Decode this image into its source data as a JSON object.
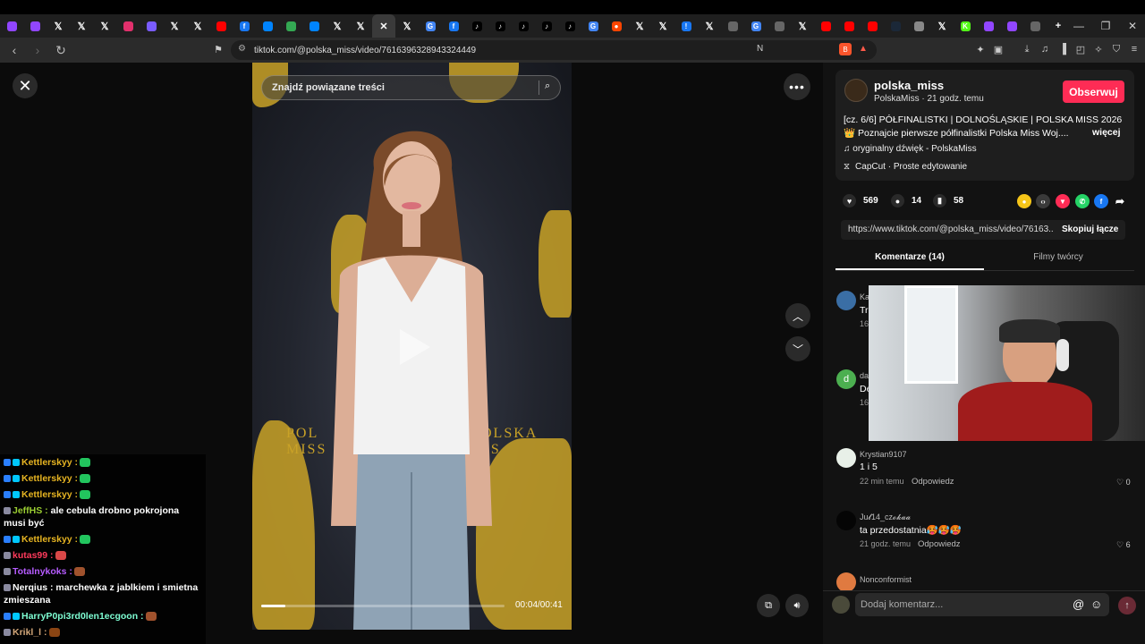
{
  "browser": {
    "url": "tiktok.com/@polska_miss/video/7616396328943324449",
    "tab_icons": [
      "twitch",
      "twitch",
      "x",
      "x",
      "x",
      "instagram",
      "feather",
      "x",
      "x",
      "youtube",
      "facebook",
      "messenger",
      "chat",
      "messenger",
      "x",
      "x",
      "close",
      "x",
      "google",
      "facebook",
      "tiktok",
      "tiktok",
      "tiktok",
      "tiktok",
      "tiktok",
      "google",
      "reddit",
      "x",
      "x",
      "exclaim",
      "x",
      "globe",
      "google",
      "globe",
      "x",
      "youtube",
      "youtube",
      "youtube",
      "steam",
      "database",
      "x",
      "kick",
      "twitch",
      "twitch",
      "globe",
      "plus"
    ],
    "window_controls": [
      "—",
      "❐",
      "✕"
    ]
  },
  "search": {
    "placeholder": "Znajdź powiązane treści"
  },
  "video": {
    "time": "00:04/00:41",
    "progress": 0.1
  },
  "chat": [
    {
      "user": "Kettlerskyy :",
      "text": "",
      "color": "#e6b422",
      "badge": true
    },
    {
      "user": "Kettlerskyy :",
      "text": "",
      "color": "#e6b422",
      "badge": true
    },
    {
      "user": "Kettlerskyy :",
      "text": "",
      "color": "#e6b422",
      "badge": true
    },
    {
      "user": "JeffHS :",
      "text": " ale cebula drobno pokrojona musi być",
      "color": "#9acd32",
      "badge": false
    },
    {
      "user": "Kettlerskyy :",
      "text": "",
      "color": "#e6b422",
      "badge": true
    },
    {
      "user": "kutas99 :",
      "text": "",
      "color": "#ff3b5c",
      "badge": false
    },
    {
      "user": "Totalnykoks :",
      "text": "",
      "color": "#b65cff",
      "badge": false
    },
    {
      "user": "Nerqius :",
      "text": " marchewka z jablkiem i smietna zmieszana",
      "color": "#ffffff",
      "badge": false
    },
    {
      "user": "HarryP0pi3rd0len1ecgoon :",
      "text": "",
      "color": "#7fffd4",
      "badge": true
    },
    {
      "user": "Krikl_l :",
      "text": "",
      "color": "#d2a679",
      "badge": false
    }
  ],
  "author": {
    "name": "polska_miss",
    "sub": "PolskaMiss · 21 godz. temu",
    "follow": "Obserwuj"
  },
  "description": {
    "line1": "[cz. 6/6] PÓŁFINALISTKI | DOLNOŚLĄSKIE | POLSKA MISS 2026",
    "line2": "👑 Poznajcie pierwsze półfinalistki Polska Miss Woj....",
    "more": "więcej",
    "sound": "♫  oryginalny dźwięk - PolskaMiss",
    "capcut": "CapCut · Proste edytowanie"
  },
  "stats": {
    "likes": "569",
    "comments": "14",
    "saves": "58"
  },
  "link": {
    "url": "https://www.tiktok.com/@polska_miss/video/76163...",
    "copy": "Skopiuj łącze"
  },
  "tabs": {
    "comments": "Komentarze (14)",
    "creator": "Filmy twórcy"
  },
  "comments": [
    {
      "name": "Ka",
      "text": "Tr",
      "meta": "16"
    },
    {
      "name": "da",
      "text": "De",
      "meta": "16"
    },
    {
      "name": "Krystian9107",
      "text": "1 i 5",
      "meta": "22 min temu",
      "reply": "Odpowiedz",
      "likes": "0"
    },
    {
      "name": "Ju𝓵14_cz𝓸𝓴𝓪𝓪",
      "text": "ta przedostatnia🥵🥵🥵",
      "meta": "21 godz. temu",
      "reply": "Odpowiedz",
      "likes": "6"
    },
    {
      "name": "Nonconformist",
      "text": "",
      "meta": ""
    }
  ],
  "composer": {
    "placeholder": "Dodaj komentarz..."
  },
  "colors": {
    "accent": "#fe2c55",
    "gold": "#c9a227"
  }
}
